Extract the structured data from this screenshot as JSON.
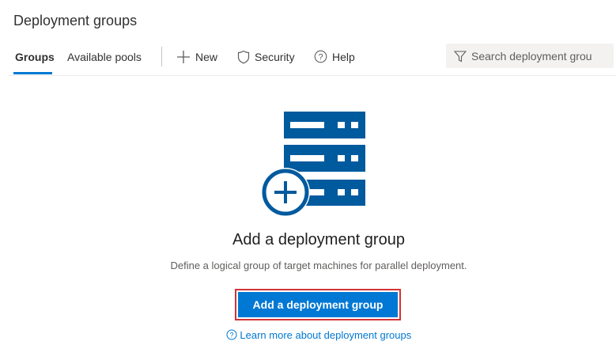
{
  "header": {
    "title": "Deployment groups"
  },
  "tabs": [
    {
      "label": "Groups",
      "selected": true
    },
    {
      "label": "Available pools"
    }
  ],
  "commands": {
    "new": "New",
    "security": "Security",
    "help": "Help"
  },
  "search": {
    "placeholder": "Search deployment grou"
  },
  "empty_state": {
    "heading": "Add a deployment group",
    "description": "Define a logical group of target machines for parallel deployment.",
    "button": "Add a deployment group",
    "learn_more": "Learn more about deployment groups"
  },
  "colors": {
    "accent": "#0078d4",
    "icon": "#005a9e",
    "highlight": "#d13438"
  }
}
